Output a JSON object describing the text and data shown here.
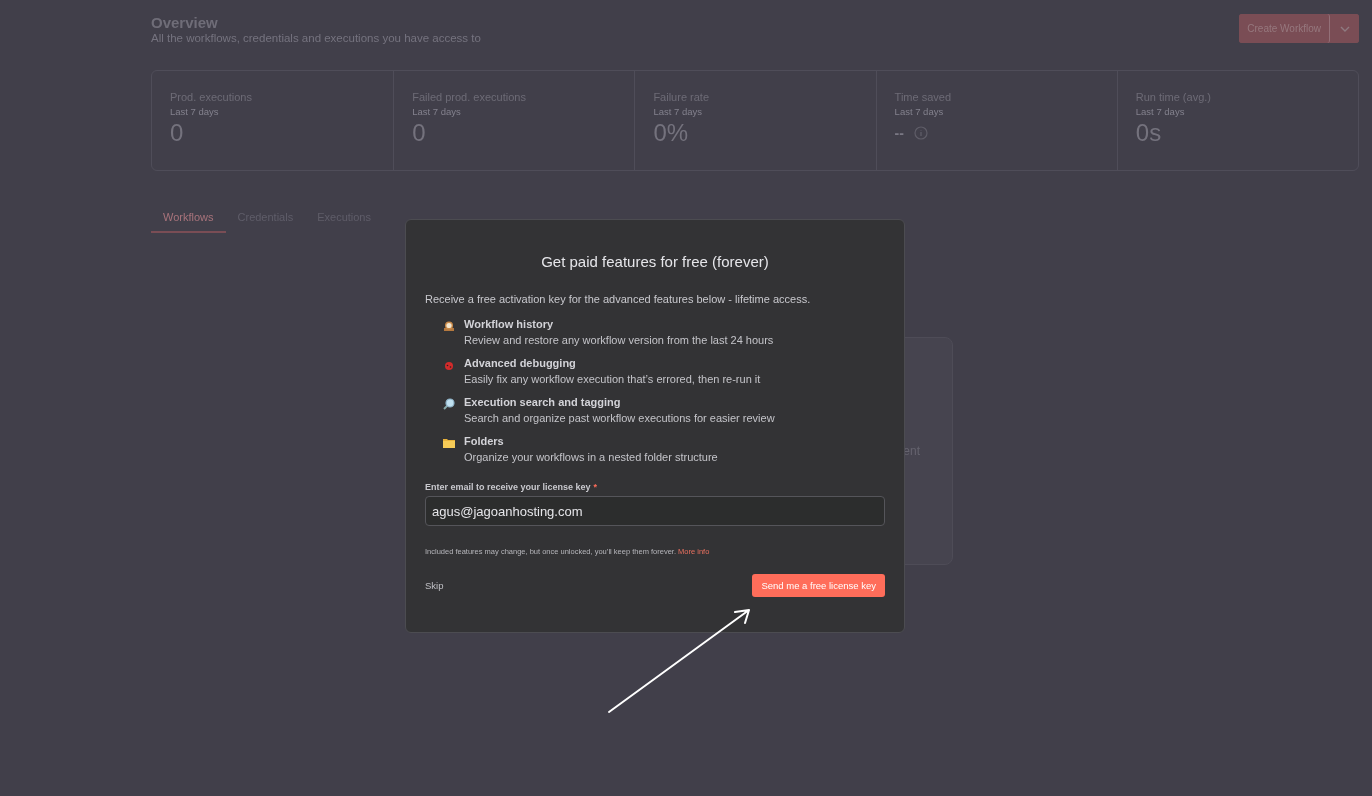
{
  "header": {
    "title": "Overview",
    "subtitle": "All the workflows, credentials and executions you have access to",
    "create_button": "Create Workflow"
  },
  "stats": [
    {
      "label": "Prod. executions",
      "period": "Last 7 days",
      "value": "0",
      "kind": "value"
    },
    {
      "label": "Failed prod. executions",
      "period": "Last 7 days",
      "value": "0",
      "kind": "value"
    },
    {
      "label": "Failure rate",
      "period": "Last 7 days",
      "value": "0%",
      "kind": "value"
    },
    {
      "label": "Time saved",
      "period": "Last 7 days",
      "value": "--",
      "kind": "placeholder"
    },
    {
      "label": "Run time (avg.)",
      "period": "Last 7 days",
      "value": "0s",
      "kind": "value"
    }
  ],
  "tabs": [
    {
      "label": "Workflows",
      "selected": true
    },
    {
      "label": "Credentials",
      "selected": false
    },
    {
      "label": "Executions",
      "selected": false
    }
  ],
  "background_card": {
    "text": "ent"
  },
  "modal": {
    "title": "Get paid features for free (forever)",
    "intro": "Receive a free activation key for the advanced features below - lifetime access.",
    "features": [
      {
        "title": "Workflow history",
        "description": "Review and restore any workflow version from the last 24 hours"
      },
      {
        "title": "Advanced debugging",
        "description": "Easily fix any workflow execution that’s errored, then re-run it"
      },
      {
        "title": "Execution search and tagging",
        "description": "Search and organize past workflow executions for easier review"
      },
      {
        "title": "Folders",
        "description": "Organize your workflows in a nested folder structure"
      }
    ],
    "email_label": "Enter email to receive your license key",
    "required_mark": "*",
    "email_value": "agus@jagoanhosting.com",
    "footnote": "Included features may change, but once unlocked, you’ll keep them forever.",
    "footnote_link": "More info",
    "skip": "Skip",
    "submit": "Send me a free license key"
  },
  "annotation": {
    "kind": "arrow"
  }
}
